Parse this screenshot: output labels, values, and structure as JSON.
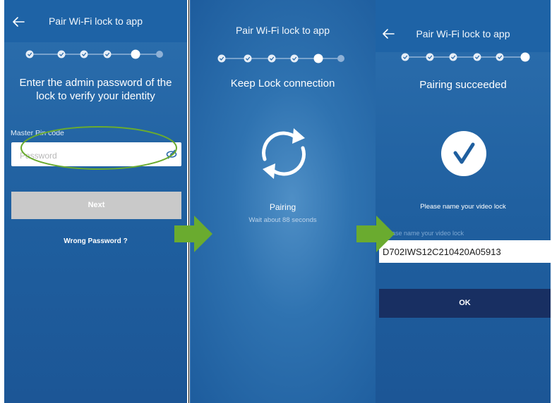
{
  "colors": {
    "panel_blue": "#1f5f9f",
    "header_blue": "#1e63a6",
    "ok_button": "#182f62",
    "next_button_disabled": "#c9c9c9",
    "annotation_green": "#6aab2f",
    "arrow_green": "#6aab2f"
  },
  "screen1": {
    "title": "Pair Wi-Fi lock to app",
    "back_icon": "arrow-left-icon",
    "steps": {
      "total": 6,
      "completed": 4,
      "current": 5
    },
    "headline_line1": "Enter the admin password of the",
    "headline_line2": "lock to verify your identity",
    "field_label": "Master Pin code",
    "password_placeholder": "Password",
    "visibility_icon": "eye-slash-icon",
    "next_label": "Next",
    "wrong_password_label": "Wrong Password ?"
  },
  "screen2": {
    "title": "Pair Wi-Fi lock to app",
    "steps": {
      "total": 6,
      "completed": 4,
      "current": 5
    },
    "headline": "Keep Lock connection",
    "sync_icon": "sync-icon",
    "status_label": "Pairing",
    "wait_label": "Wait about 88 seconds"
  },
  "screen3": {
    "title": "Pair Wi-Fi lock to app",
    "back_icon": "arrow-left-icon",
    "steps": {
      "total": 6,
      "completed": 5,
      "current": 6
    },
    "headline": "Pairing succeeded",
    "check_icon": "checkmark-icon",
    "prompt_label": "Please name your video lock",
    "name_field_label": "Please name your video lock",
    "name_value": "D702IWS12C210420A05913",
    "ok_label": "OK"
  }
}
